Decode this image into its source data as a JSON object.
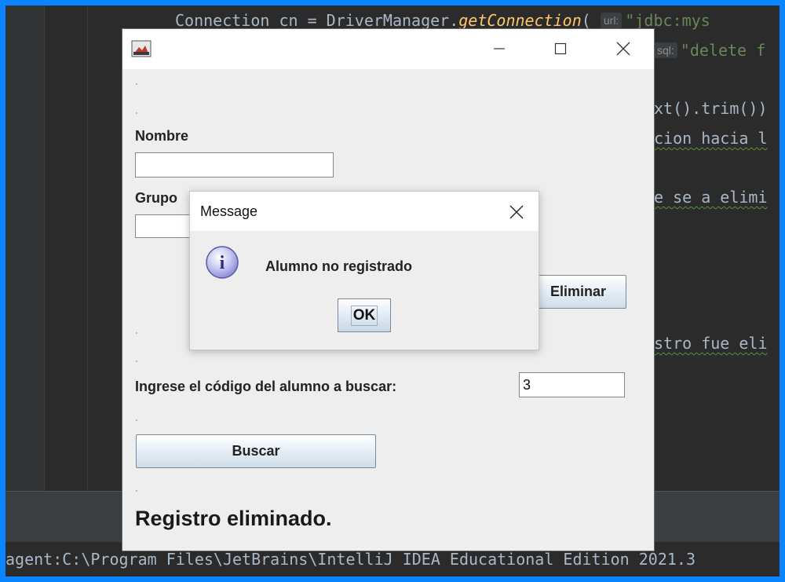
{
  "ide": {
    "code_lines": {
      "line1": {
        "prefix": "Connection cn = DriverManager.",
        "method": "getConnection",
        "open": "(",
        "hint_url": "url:",
        "str": "\"jdbc:mys"
      },
      "line2": {
        "hint_sql": "sql:",
        "str": "\"delete f"
      },
      "line3": "xt().trim())",
      "line4": "cion hacia l",
      "line5": "e se a elimi",
      "line6": "stro fue eli"
    },
    "console_text": "agent:C:\\Program Files\\JetBrains\\IntelliJ IDEA Educational Edition 2021.3"
  },
  "frame": {
    "icon": "java-app-icon",
    "controls": {
      "minimize_icon": "minimize-icon",
      "maximize_icon": "maximize-icon",
      "close_icon": "close-icon"
    },
    "nombre_label": "Nombre",
    "nombre_value": "",
    "grupo_label": "Grupo",
    "grupo_value": "",
    "eliminar_button": "Eliminar",
    "codigo_label": "Ingrese el código del alumno a buscar:",
    "codigo_value": "3",
    "buscar_button": "Buscar",
    "status_text": "Registro eliminado."
  },
  "dialog": {
    "title": "Message",
    "icon": "info-icon",
    "message": "Alumno no registrado",
    "ok_button": "OK"
  }
}
